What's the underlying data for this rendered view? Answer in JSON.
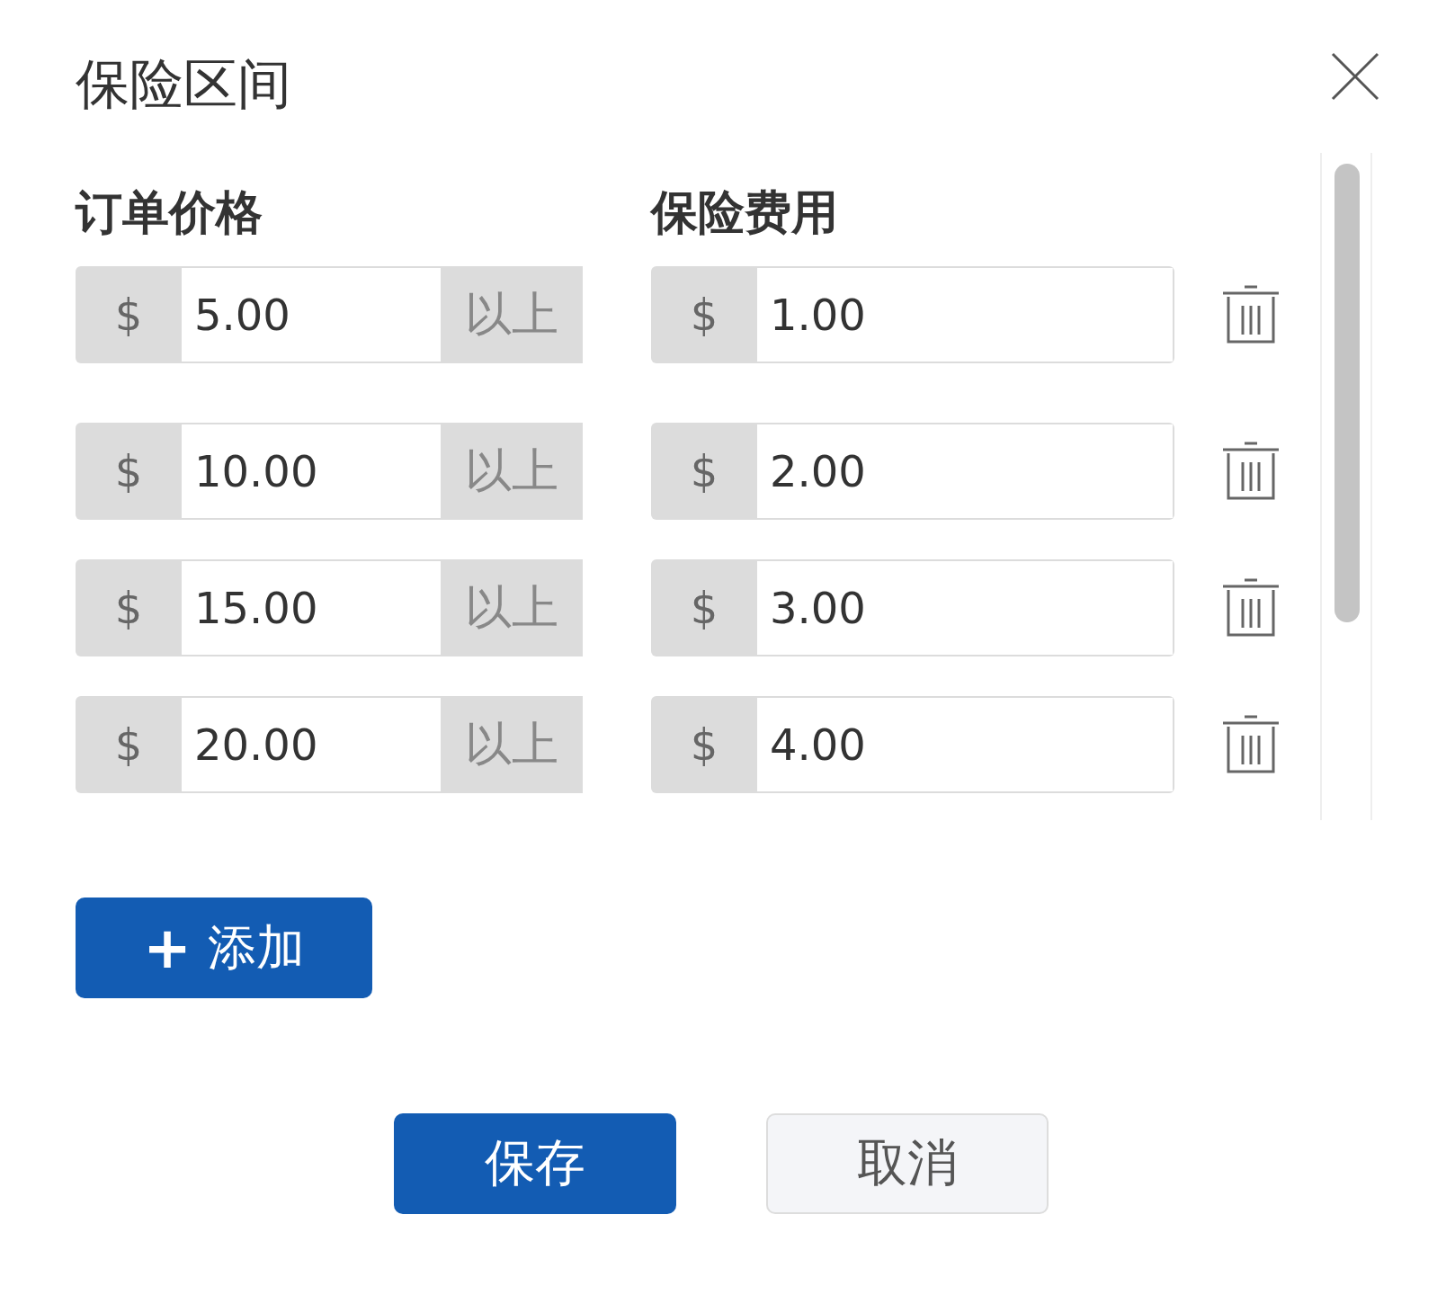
{
  "dialog": {
    "title": "保险区间",
    "columns": [
      "订单价格",
      "保险费用"
    ],
    "rows": [
      {
        "price_prefix": "$",
        "price": "5.00",
        "price_suffix": "以上",
        "fee_prefix": "$",
        "fee": "1.00"
      },
      {
        "price_prefix": "$",
        "price": "10.00",
        "price_suffix": "以上",
        "fee_prefix": "$",
        "fee": "2.00"
      },
      {
        "price_prefix": "$",
        "price": "15.00",
        "price_suffix": "以上",
        "fee_prefix": "$",
        "fee": "3.00"
      },
      {
        "price_prefix": "$",
        "price": "20.00",
        "price_suffix": "以上",
        "fee_prefix": "$",
        "fee": "4.00"
      }
    ],
    "add_button": {
      "icon": "+",
      "label": "添加"
    },
    "buttons": [
      {
        "label": "保存",
        "kind": "primary"
      },
      {
        "label": "取消",
        "kind": "secondary"
      }
    ]
  }
}
